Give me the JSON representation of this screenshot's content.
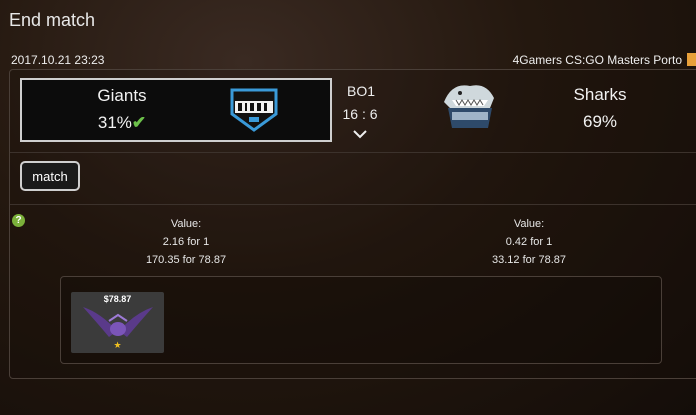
{
  "page_title": "End match",
  "date": "2017.10.21 23:23",
  "event": "4Gamers CS:GO Masters Porto",
  "team_left": {
    "name": "Giants",
    "percent": "31%"
  },
  "team_right": {
    "name": "Sharks",
    "percent": "69%"
  },
  "match_format": "BO1",
  "score": "16 : 6",
  "match_button": "match",
  "help_label": "?",
  "left_value": {
    "label": "Value:",
    "ratio": "2.16 for 1",
    "amounts": "170.35 for 78.87"
  },
  "right_value": {
    "label": "Value:",
    "ratio": "0.42 for 1",
    "amounts": "33.12 for 78.87"
  },
  "item": {
    "price": "$78.87",
    "rarity_icon": "star-icon"
  },
  "colors": {
    "winner_check": "#6cc04a",
    "accent_blue": "#3a9ad9",
    "item_star": "#f0c020"
  }
}
